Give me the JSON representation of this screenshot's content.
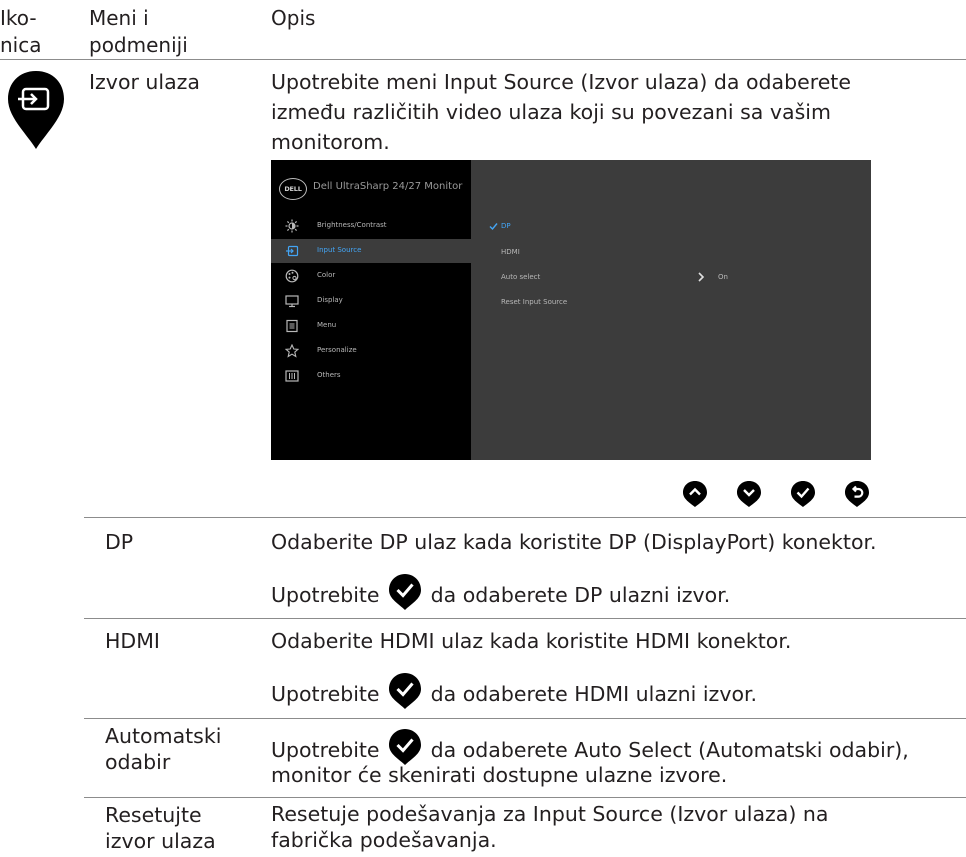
{
  "header": {
    "col_icon": "Iko-\nnica",
    "col_menu": "Meni i\npodmeniji",
    "col_desc": "Opis"
  },
  "input_source": {
    "menu_name": "Izvor ulaza",
    "description": "Upotrebite meni Input Source (Izvor ulaza) da odaberete između različitih video ulaza koji su povezani sa vašim monitorom."
  },
  "osd": {
    "logo": "DELL",
    "title": "Dell UltraSharp 24/27 Monitor",
    "menu_items": [
      {
        "label": "Brightness/Contrast",
        "icon": "brightness-icon"
      },
      {
        "label": "Input Source",
        "icon": "input-icon",
        "selected": true
      },
      {
        "label": "Color",
        "icon": "palette-icon"
      },
      {
        "label": "Display",
        "icon": "display-icon"
      },
      {
        "label": "Menu",
        "icon": "menu-icon"
      },
      {
        "label": "Personalize",
        "icon": "star-icon"
      },
      {
        "label": "Others",
        "icon": "others-icon"
      }
    ],
    "options": [
      {
        "label": "DP",
        "selected": true
      },
      {
        "label": "HDMI"
      },
      {
        "label": "Auto select",
        "value": "On"
      },
      {
        "label": "Reset Input Source"
      }
    ],
    "colors": {
      "highlight": "#43a5f5",
      "left_bg": "#000000",
      "right_bg": "#3c3c3c"
    }
  },
  "nav_buttons": [
    "up-icon",
    "down-icon",
    "check-icon",
    "back-icon"
  ],
  "rows": [
    {
      "name": "DP",
      "line1": "Odaberite DP ulaz kada koristite DP (DisplayPort) konektor.",
      "line2_before": "Upotrebite",
      "line2_after": "da odaberete DP ulazni izvor."
    },
    {
      "name": "HDMI",
      "line1": "Odaberite HDMI ulaz kada koristite HDMI konektor.",
      "line2_before": "Upotrebite",
      "line2_after": "da odaberete HDMI ulazni izvor."
    },
    {
      "name": "Automatski\nodabir",
      "line1_before": "Upotrebite",
      "line1_after": "da odaberete Auto Select (Automatski odabir),",
      "line2": "monitor će skenirati dostupne ulazne izvore."
    },
    {
      "name": "Resetujte\nizvor ulaza",
      "desc": "Resetuje podešavanja za Input Source (Izvor ulaza) na fabrička podešavanja."
    }
  ]
}
